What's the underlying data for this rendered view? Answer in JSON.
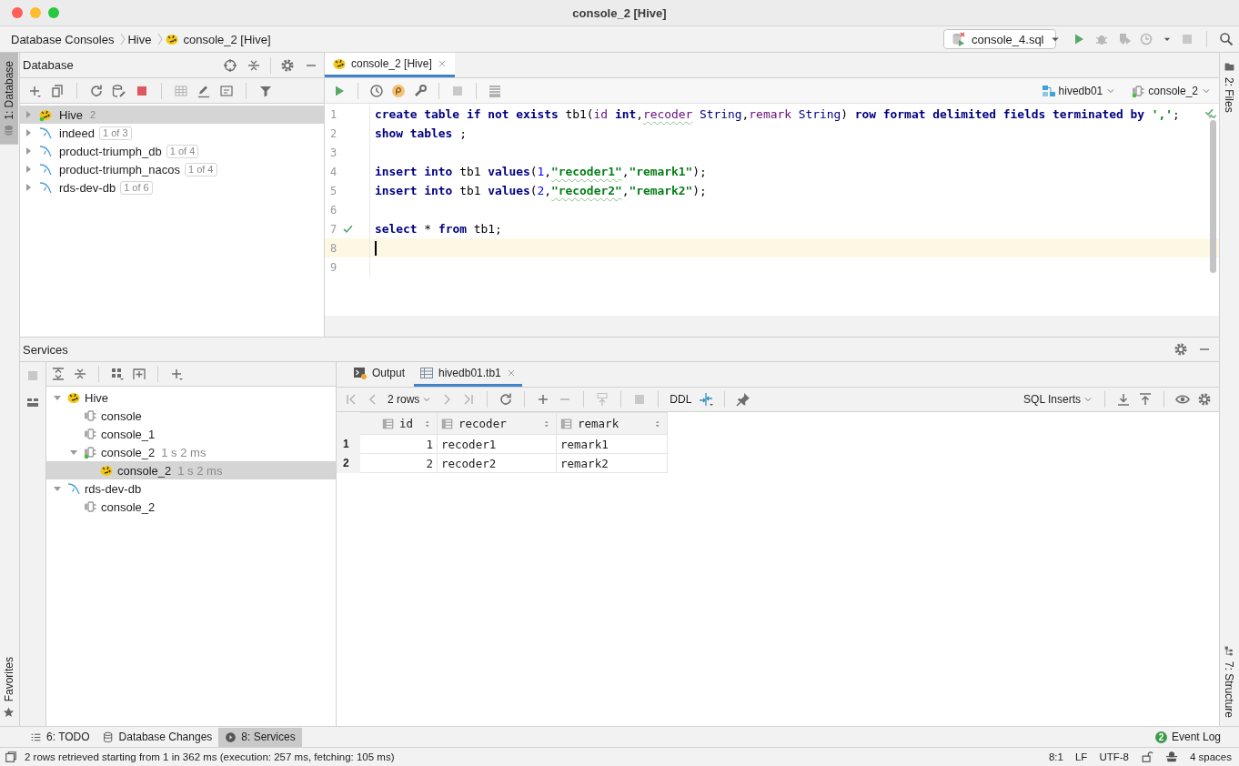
{
  "window": {
    "title": "console_2 [Hive]"
  },
  "breadcrumbs": [
    {
      "label": "Database Consoles",
      "kind": "plain"
    },
    {
      "label": "Hive",
      "kind": "plain"
    },
    {
      "label": "console_2 [Hive]",
      "kind": "hive"
    }
  ],
  "run_config": {
    "label": "console_4.sql"
  },
  "left_stripe": {
    "top": [
      {
        "label": "1: Database",
        "selected": true
      }
    ],
    "bottom": [
      {
        "label": "Favorites",
        "selected": false
      }
    ]
  },
  "right_stripe": {
    "top": [
      {
        "label": "2: Files",
        "selected": false
      }
    ],
    "bottom": [
      {
        "label": "7: Structure",
        "selected": false
      }
    ]
  },
  "database_panel": {
    "title": "Database",
    "tree": [
      {
        "label": "Hive",
        "badge": "2",
        "kind": "hive",
        "selected": true,
        "expanded": false,
        "connected": true
      },
      {
        "label": "indeed",
        "badge": "1 of 3",
        "kind": "mysql",
        "selected": false,
        "expanded": false,
        "connected": false
      },
      {
        "label": "product-triumph_db",
        "badge": "1 of 4",
        "kind": "mysql",
        "selected": false,
        "expanded": false,
        "connected": false
      },
      {
        "label": "product-triumph_nacos",
        "badge": "1 of 4",
        "kind": "mysql",
        "selected": false,
        "expanded": false,
        "connected": false
      },
      {
        "label": "rds-dev-db",
        "badge": "1 of 6",
        "kind": "mysql",
        "selected": false,
        "expanded": false,
        "connected": false
      }
    ]
  },
  "editor": {
    "tabs": [
      {
        "label": "console_2 [Hive]",
        "selected": true
      }
    ],
    "schema": "hivedb01",
    "session": "console_2",
    "lines": [
      {
        "number": "1",
        "executed": false,
        "current": false,
        "tokens": [
          {
            "text": "create table if not exists ",
            "kind": "kw"
          },
          {
            "text": "tb1(",
            "kind": "plain"
          },
          {
            "text": "id",
            "kind": "field"
          },
          {
            "text": " int",
            "kind": "kw"
          },
          {
            "text": ",",
            "kind": "plain"
          },
          {
            "text": "recoder",
            "kind": "field",
            "typo": true
          },
          {
            "text": " String",
            "kind": "type"
          },
          {
            "text": ",",
            "kind": "plain"
          },
          {
            "text": "remark",
            "kind": "field"
          },
          {
            "text": " String",
            "kind": "type"
          },
          {
            "text": ") ",
            "kind": "plain"
          },
          {
            "text": "row format delimited fields terminated by ",
            "kind": "kw"
          },
          {
            "text": "','",
            "kind": "str"
          },
          {
            "text": ";",
            "kind": "plain"
          }
        ]
      },
      {
        "number": "2",
        "executed": false,
        "current": false,
        "tokens": [
          {
            "text": "show tables",
            "kind": "kw"
          },
          {
            "text": " ;",
            "kind": "plain"
          }
        ]
      },
      {
        "number": "3",
        "executed": false,
        "current": false
      },
      {
        "number": "4",
        "executed": false,
        "current": false,
        "tokens": [
          {
            "text": "insert into",
            "kind": "kw"
          },
          {
            "text": " tb1 ",
            "kind": "plain"
          },
          {
            "text": "values",
            "kind": "kw"
          },
          {
            "text": "(",
            "kind": "plain"
          },
          {
            "text": "1",
            "kind": "num"
          },
          {
            "text": ",",
            "kind": "plain"
          },
          {
            "text": "\"recoder1\"",
            "kind": "str",
            "typo": true
          },
          {
            "text": ",",
            "kind": "plain"
          },
          {
            "text": "\"remark1\"",
            "kind": "str"
          },
          {
            "text": ");",
            "kind": "plain"
          }
        ]
      },
      {
        "number": "5",
        "executed": false,
        "current": false,
        "tokens": [
          {
            "text": "insert into",
            "kind": "kw"
          },
          {
            "text": " tb1 ",
            "kind": "plain"
          },
          {
            "text": "values",
            "kind": "kw"
          },
          {
            "text": "(",
            "kind": "plain"
          },
          {
            "text": "2",
            "kind": "num"
          },
          {
            "text": ",",
            "kind": "plain"
          },
          {
            "text": "\"recoder2\"",
            "kind": "str",
            "typo": true
          },
          {
            "text": ",",
            "kind": "plain"
          },
          {
            "text": "\"remark2\"",
            "kind": "str"
          },
          {
            "text": ");",
            "kind": "plain"
          }
        ]
      },
      {
        "number": "6",
        "executed": false,
        "current": false
      },
      {
        "number": "7",
        "executed": true,
        "current": false,
        "tokens": [
          {
            "text": "select",
            "kind": "kw"
          },
          {
            "text": " * ",
            "kind": "plain"
          },
          {
            "text": "from",
            "kind": "kw"
          },
          {
            "text": " tb1;",
            "kind": "plain"
          }
        ]
      },
      {
        "number": "8",
        "executed": false,
        "current": true
      },
      {
        "number": "9",
        "executed": false,
        "current": false
      }
    ]
  },
  "services": {
    "title": "Services",
    "tree": [
      {
        "label": "Hive",
        "kind": "hive",
        "expanded": true,
        "selected": false,
        "connected": false,
        "children": [
          {
            "label": "console",
            "kind": "console",
            "selected": false,
            "connected": false
          },
          {
            "label": "console_1",
            "kind": "console",
            "selected": false,
            "connected": false
          },
          {
            "label": "console_2",
            "time": "1 s 2 ms",
            "kind": "console",
            "expanded": true,
            "selected": false,
            "connected": true,
            "children": [
              {
                "label": "console_2",
                "time": "1 s 2 ms",
                "kind": "hive",
                "selected": true,
                "connected": false
              }
            ]
          }
        ]
      },
      {
        "label": "rds-dev-db",
        "kind": "mysql",
        "expanded": true,
        "selected": false,
        "connected": false,
        "children": [
          {
            "label": "console_2",
            "kind": "console",
            "selected": false,
            "connected": false
          }
        ]
      }
    ],
    "result_tabs": [
      {
        "label": "Output",
        "kind": "output",
        "selected": false
      },
      {
        "label": "hivedb01.tb1",
        "kind": "table",
        "selected": true
      }
    ],
    "rows_label": "2 rows",
    "ddl_label": "DDL",
    "export_format": "SQL Inserts",
    "table": {
      "columns": [
        "id",
        "recoder",
        "remark"
      ],
      "rows": [
        {
          "number": "1",
          "cells": [
            "1",
            "recoder1",
            "remark1"
          ]
        },
        {
          "number": "2",
          "cells": [
            "2",
            "recoder2",
            "remark2"
          ]
        }
      ]
    }
  },
  "tool_windows": [
    {
      "label": "6: TODO",
      "kind": "todo",
      "selected": false
    },
    {
      "label": "Database Changes",
      "kind": "changes",
      "selected": false
    },
    {
      "label": "8: Services",
      "kind": "services",
      "selected": true
    }
  ],
  "event_log": {
    "label": "Event Log",
    "badge": "2"
  },
  "status_bar": {
    "message": "2 rows retrieved starting from 1 in 362 ms (execution: 257 ms, fetching: 105 ms)",
    "position": "8:1",
    "line_separator": "LF",
    "encoding": "UTF-8",
    "indent": "4 spaces"
  }
}
